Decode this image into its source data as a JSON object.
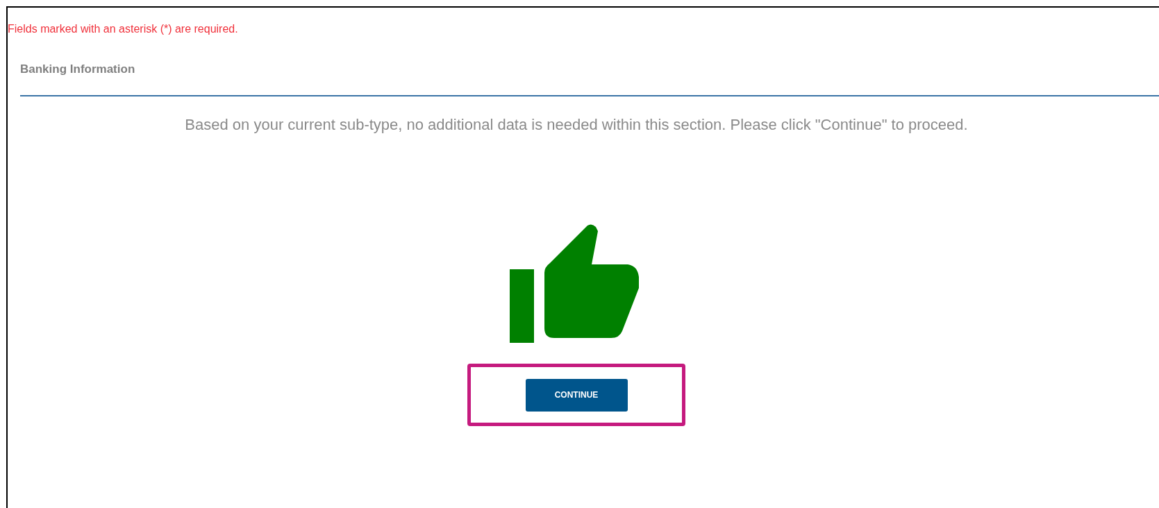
{
  "required_note": "Fields marked with an asterisk (*) are required.",
  "section": {
    "title": "Banking Information"
  },
  "message": "Based on your current sub-type, no additional data is needed within this section. Please click \"Continue\" to proceed.",
  "continue_button": {
    "label": "CONTINUE",
    "highlighted": true
  }
}
